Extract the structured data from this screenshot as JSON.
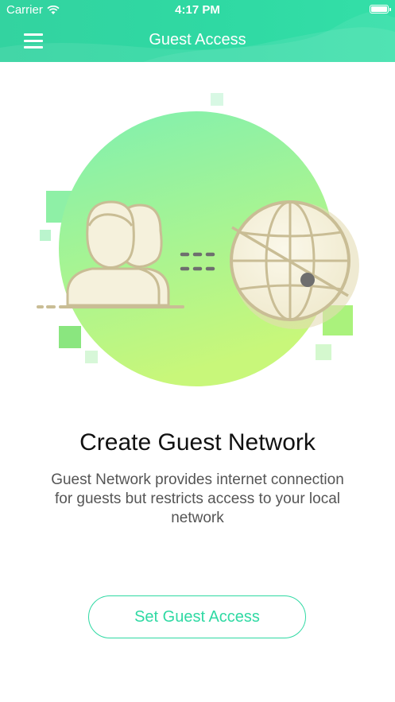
{
  "status_bar": {
    "carrier": "Carrier",
    "time": "4:17 PM"
  },
  "nav": {
    "title": "Guest Access",
    "menu_icon": "hamburger-menu-icon"
  },
  "illustration": {
    "icons": [
      "guest-users-icon",
      "connection-dots-icon",
      "globe-icon"
    ],
    "colors": {
      "circle_top": "#7ff0b0",
      "circle_bottom": "#c8f77a",
      "icon_fill": "#f5f1dc",
      "icon_stroke": "#c9bd95"
    }
  },
  "content": {
    "headline": "Create Guest Network",
    "description": "Guest Network provides internet connection for guests but restricts access to your local network"
  },
  "actions": {
    "primary_label": "Set Guest Access"
  },
  "theme": {
    "accent": "#2fd9a3",
    "header_bg": "#33d6a3",
    "text_primary": "#111111",
    "text_secondary": "#555555"
  }
}
